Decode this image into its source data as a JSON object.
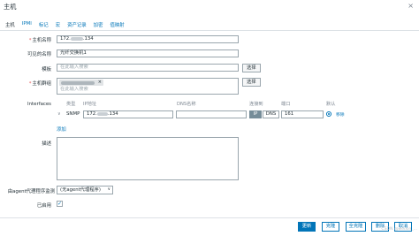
{
  "dialog": {
    "title": "主机",
    "close_glyph": "×"
  },
  "tabs": [
    "主机",
    "IPMI",
    "标记",
    "宏",
    "资产记录",
    "加密",
    "值映射"
  ],
  "form": {
    "hostname": {
      "label": "主机名称",
      "value_prefix": "172.",
      "value_suffix": ".134"
    },
    "visible_name": {
      "label": "可见的名称",
      "value": "光纤交换机1"
    },
    "templates": {
      "label": "模板",
      "placeholder": "在此输入搜索",
      "button": "选择"
    },
    "host_groups": {
      "label": "主机群组",
      "placeholder": "在此输入搜索",
      "button": "选择",
      "chip_remove": "×"
    },
    "interfaces": {
      "label": "Interfaces",
      "columns": {
        "type": "类型",
        "ip": "IP地址",
        "dns": "DNS名称",
        "connect": "连接到",
        "port": "端口",
        "default": "默认"
      },
      "row": {
        "type": "SNMP",
        "ip_prefix": "172.",
        "ip_suffix": ".134",
        "dns_value": "",
        "connect_ip": "IP",
        "connect_dns": "DNS",
        "port": "161",
        "remove": "移除"
      },
      "add_link": "添加"
    },
    "description": {
      "label": "描述",
      "value": ""
    },
    "proxy": {
      "label": "由agent代理程序监测",
      "value": "(无agent代理程序)"
    },
    "enabled": {
      "label": "已启用",
      "checked": true
    }
  },
  "footer": {
    "update": "更新",
    "clone": "克隆",
    "full_clone": "全克隆",
    "delete": "删除",
    "cancel": "取消"
  },
  "watermark": "CSDN @weixin_..."
}
